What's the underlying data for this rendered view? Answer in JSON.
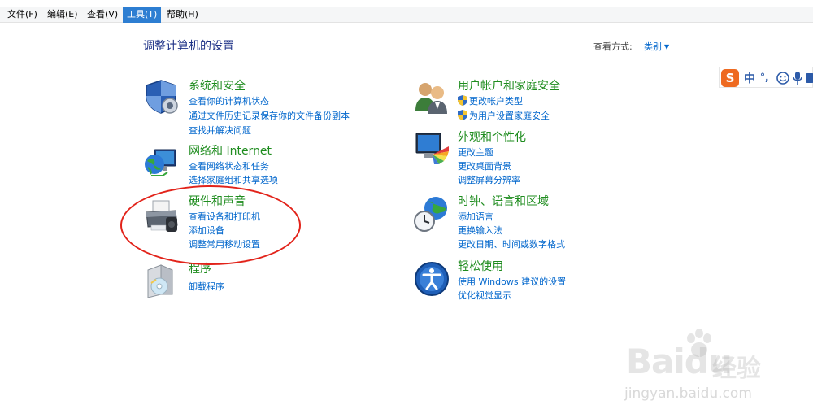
{
  "menubar": {
    "items": [
      {
        "label": "文件(F)"
      },
      {
        "label": "编辑(E)"
      },
      {
        "label": "查看(V)"
      },
      {
        "label": "工具(T)",
        "active": true
      },
      {
        "label": "帮助(H)"
      }
    ]
  },
  "page": {
    "title": "调整计算机的设置",
    "view_label": "查看方式:",
    "view_value": "类别"
  },
  "categories": {
    "security": {
      "title": "系统和安全",
      "icon": "shield-icon",
      "links": [
        "查看你的计算机状态",
        "通过文件历史记录保存你的文件备份副本",
        "查找并解决问题"
      ]
    },
    "network": {
      "title": "网络和 Internet",
      "icon": "network-globe-icon",
      "links": [
        "查看网络状态和任务",
        "选择家庭组和共享选项"
      ]
    },
    "hardware": {
      "title": "硬件和声音",
      "icon": "printer-icon",
      "links": [
        "查看设备和打印机",
        "添加设备",
        "调整常用移动设置"
      ]
    },
    "programs": {
      "title": "程序",
      "icon": "programs-disc-icon",
      "links": [
        "卸载程序"
      ]
    },
    "users": {
      "title": "用户帐户和家庭安全",
      "icon": "users-icon",
      "links": [
        "更改帐户类型",
        "为用户设置家庭安全"
      ]
    },
    "appearance": {
      "title": "外观和个性化",
      "icon": "monitor-palette-icon",
      "links": [
        "更改主题",
        "更改桌面背景",
        "调整屏幕分辨率"
      ]
    },
    "clock": {
      "title": "时钟、语言和区域",
      "icon": "clock-globe-icon",
      "links": [
        "添加语言",
        "更换输入法",
        "更改日期、时间或数字格式"
      ]
    },
    "ease": {
      "title": "轻松使用",
      "icon": "ease-of-access-icon",
      "links": [
        "使用 Windows 建议的设置",
        "优化视觉显示"
      ]
    }
  },
  "ime": {
    "logo": "S",
    "mode": "中",
    "punct": "°,"
  },
  "watermark": {
    "brand": "Bai",
    "brand2": "du",
    "cn": "经验",
    "url": "jingyan.baidu.com"
  },
  "colors": {
    "link": "#0066cc",
    "category_title": "#1e8c1e",
    "page_title": "#1e3287",
    "menu_active": "#2d7ed2",
    "annotation": "#e2231a"
  }
}
